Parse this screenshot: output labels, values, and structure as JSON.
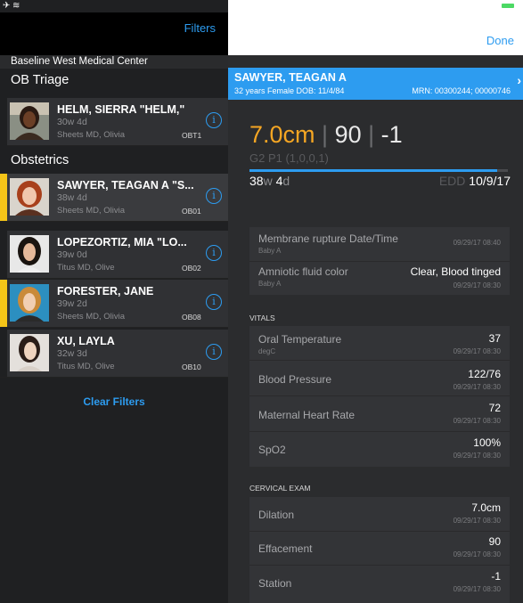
{
  "left": {
    "filters_label": "Filters",
    "facility": "Baseline West Medical Center",
    "triage_header": "OB Triage",
    "obstetrics_header": "Obstetrics",
    "clear_filters_label": "Clear Filters",
    "triage_patients": [
      {
        "name": "HELM, SIERRA \"HELM,\"",
        "ga": "30w 4d",
        "doctor": "Sheets MD, Olivia",
        "code": "OBT1"
      }
    ],
    "ob_patients": [
      {
        "name": "SAWYER, TEAGAN A \"S...",
        "ga": "38w 4d",
        "doctor": "Sheets MD, Olivia",
        "code": "OB01",
        "accent": "#f5c518"
      },
      {
        "name": "LOPEZORTIZ, MIA \"LO...",
        "ga": "39w 0d",
        "doctor": "Titus MD, Olive",
        "code": "OB02",
        "accent": "#1f2022"
      },
      {
        "name": "FORESTER, JANE",
        "ga": "39w 2d",
        "doctor": "Sheets MD, Olivia",
        "code": "OB08",
        "accent": "#f5c518"
      },
      {
        "name": "XU, LAYLA",
        "ga": "32w 3d",
        "doctor": "Titus MD, Olive",
        "code": "OB10",
        "accent": "#1f2022"
      }
    ]
  },
  "right": {
    "done_label": "Done",
    "banner": {
      "name": "SAWYER, TEAGAN A",
      "demographics": "32 years  Female  DOB: 11/4/84",
      "mrn": "MRN: 00300244; 00000746"
    },
    "cervix": {
      "dilation": "7.0cm",
      "sep": "|",
      "effacement": "90",
      "station": "-1"
    },
    "gp": "G2 P1 (1,0,0,1)",
    "ga": {
      "weeks": "38",
      "w": "w",
      "days": "4",
      "d": "d"
    },
    "pregnancy_progress": 0.96,
    "edd": {
      "label": "EDD",
      "value": "10/9/17"
    },
    "membrane_card": [
      {
        "label": "Membrane rupture Date/Time",
        "sub": "Baby A",
        "value": "",
        "time": "09/29/17 08:40"
      },
      {
        "label": "Amniotic fluid color",
        "sub": "Baby A",
        "value": "Clear, Blood tinged",
        "time": "09/29/17 08:30"
      }
    ],
    "vitals_header": "VITALS",
    "vitals": [
      {
        "label": "Oral Temperature",
        "sub": "degC",
        "value": "37",
        "time": "09/29/17 08:30"
      },
      {
        "label": "Blood Pressure",
        "sub": "",
        "value": "122/76",
        "time": "09/29/17 08:30"
      },
      {
        "label": "Maternal Heart Rate",
        "sub": "",
        "value": "72",
        "time": "09/29/17 08:30"
      },
      {
        "label": "SpO2",
        "sub": "",
        "value": "100%",
        "time": "09/29/17 08:30"
      }
    ],
    "cervical_header": "CERVICAL EXAM",
    "cervical": [
      {
        "label": "Dilation",
        "sub": "",
        "value": "7.0cm",
        "time": "09/29/17 08:30"
      },
      {
        "label": "Effacement",
        "sub": "",
        "value": "90",
        "time": "09/29/17 08:30"
      },
      {
        "label": "Station",
        "sub": "",
        "value": "-1",
        "time": "09/29/17 08:30"
      }
    ]
  }
}
